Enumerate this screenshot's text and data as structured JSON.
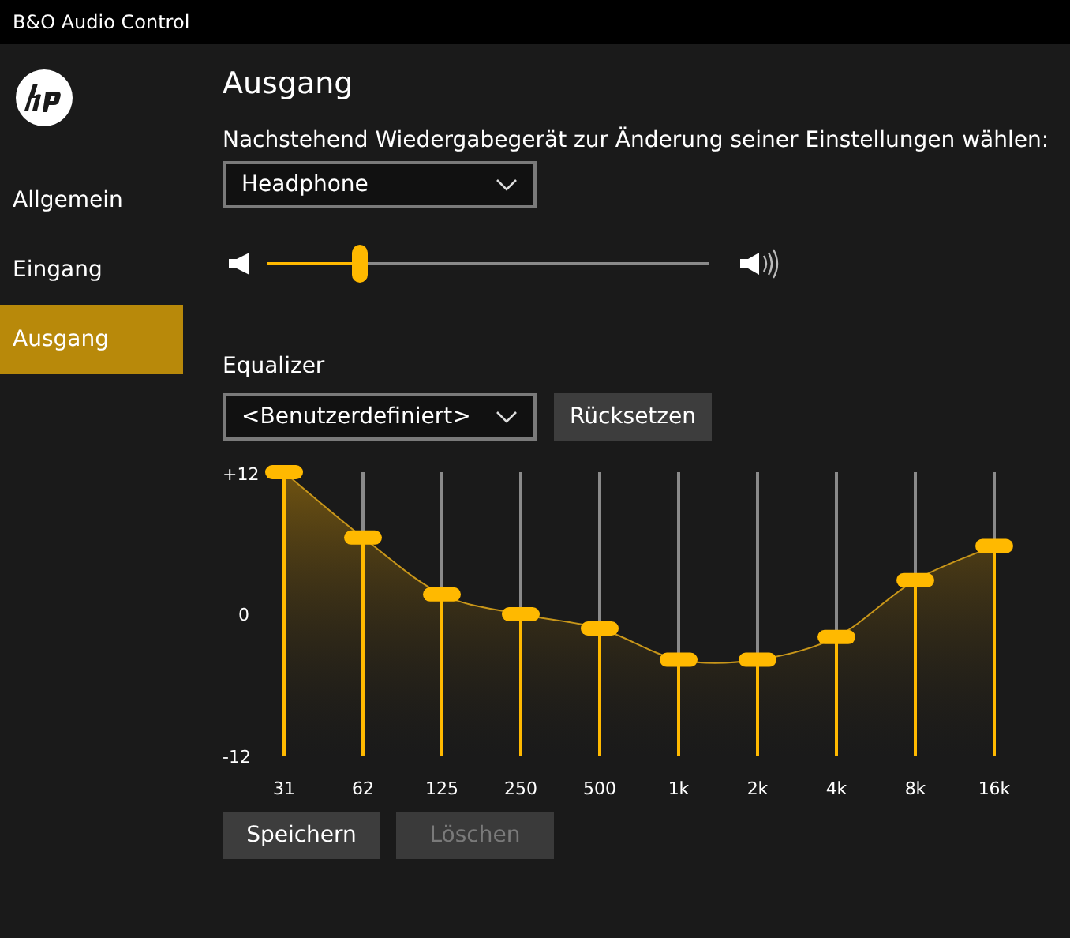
{
  "window": {
    "title": "B&O Audio Control"
  },
  "sidebar": {
    "items": [
      {
        "label": "Allgemein",
        "selected": false
      },
      {
        "label": "Eingang",
        "selected": false
      },
      {
        "label": "Ausgang",
        "selected": true
      }
    ]
  },
  "page": {
    "title": "Ausgang",
    "instruction": "Nachstehend Wiedergabegerät zur Änderung seiner Einstellungen wählen:",
    "device": {
      "value": "Headphone"
    },
    "volume": {
      "level": 0.21
    }
  },
  "equalizer": {
    "label": "Equalizer",
    "preset": {
      "value": "<Benutzerdefiniert>"
    },
    "reset_button": {
      "label": "Rücksetzen",
      "disabled": false
    },
    "scale_labels": [
      "+12",
      "0",
      "-12"
    ],
    "bands": [
      {
        "label": "31",
        "level": 1.0
      },
      {
        "label": "62",
        "level": 0.77
      },
      {
        "label": "125",
        "level": 0.57
      },
      {
        "label": "250",
        "level": 0.5
      },
      {
        "label": "500",
        "level": 0.45
      },
      {
        "label": "1k",
        "level": 0.34
      },
      {
        "label": "2k",
        "level": 0.34
      },
      {
        "label": "4k",
        "level": 0.42
      },
      {
        "label": "8k",
        "level": 0.62
      },
      {
        "label": "16k",
        "level": 0.74
      }
    ]
  },
  "buttons": [
    {
      "label": "Speichern",
      "disabled": false
    },
    {
      "label": "Löschen",
      "disabled": true
    }
  ]
}
